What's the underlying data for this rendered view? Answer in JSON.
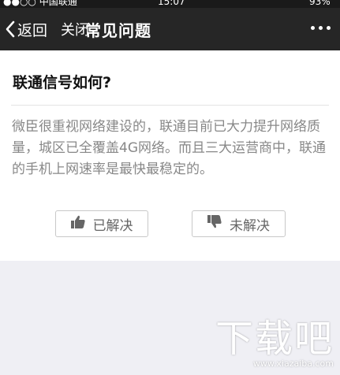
{
  "status_bar": {
    "carrier": "●●○○ 中国联通",
    "time": "15:07",
    "battery": "93%"
  },
  "nav": {
    "back_label": "返回",
    "close_label": "关闭",
    "title": "常见问题",
    "more_icon": "more-icon"
  },
  "question": {
    "title": "联通信号如何?",
    "answer": "微臣很重视网络建设的，联通目前已大力提升网络质量，城区已全覆盖4G网络。而且三大运营商中，联通的手机上网速率是最快最稳定的。"
  },
  "feedback": {
    "solved_label": "已解决",
    "unsolved_label": "未解决"
  },
  "watermark": {
    "logo": "下载吧",
    "url": "www.xiazaiba.com"
  },
  "colors": {
    "nav_bg": "#262626",
    "page_bg": "#efeff4",
    "answer_text": "#888888"
  }
}
